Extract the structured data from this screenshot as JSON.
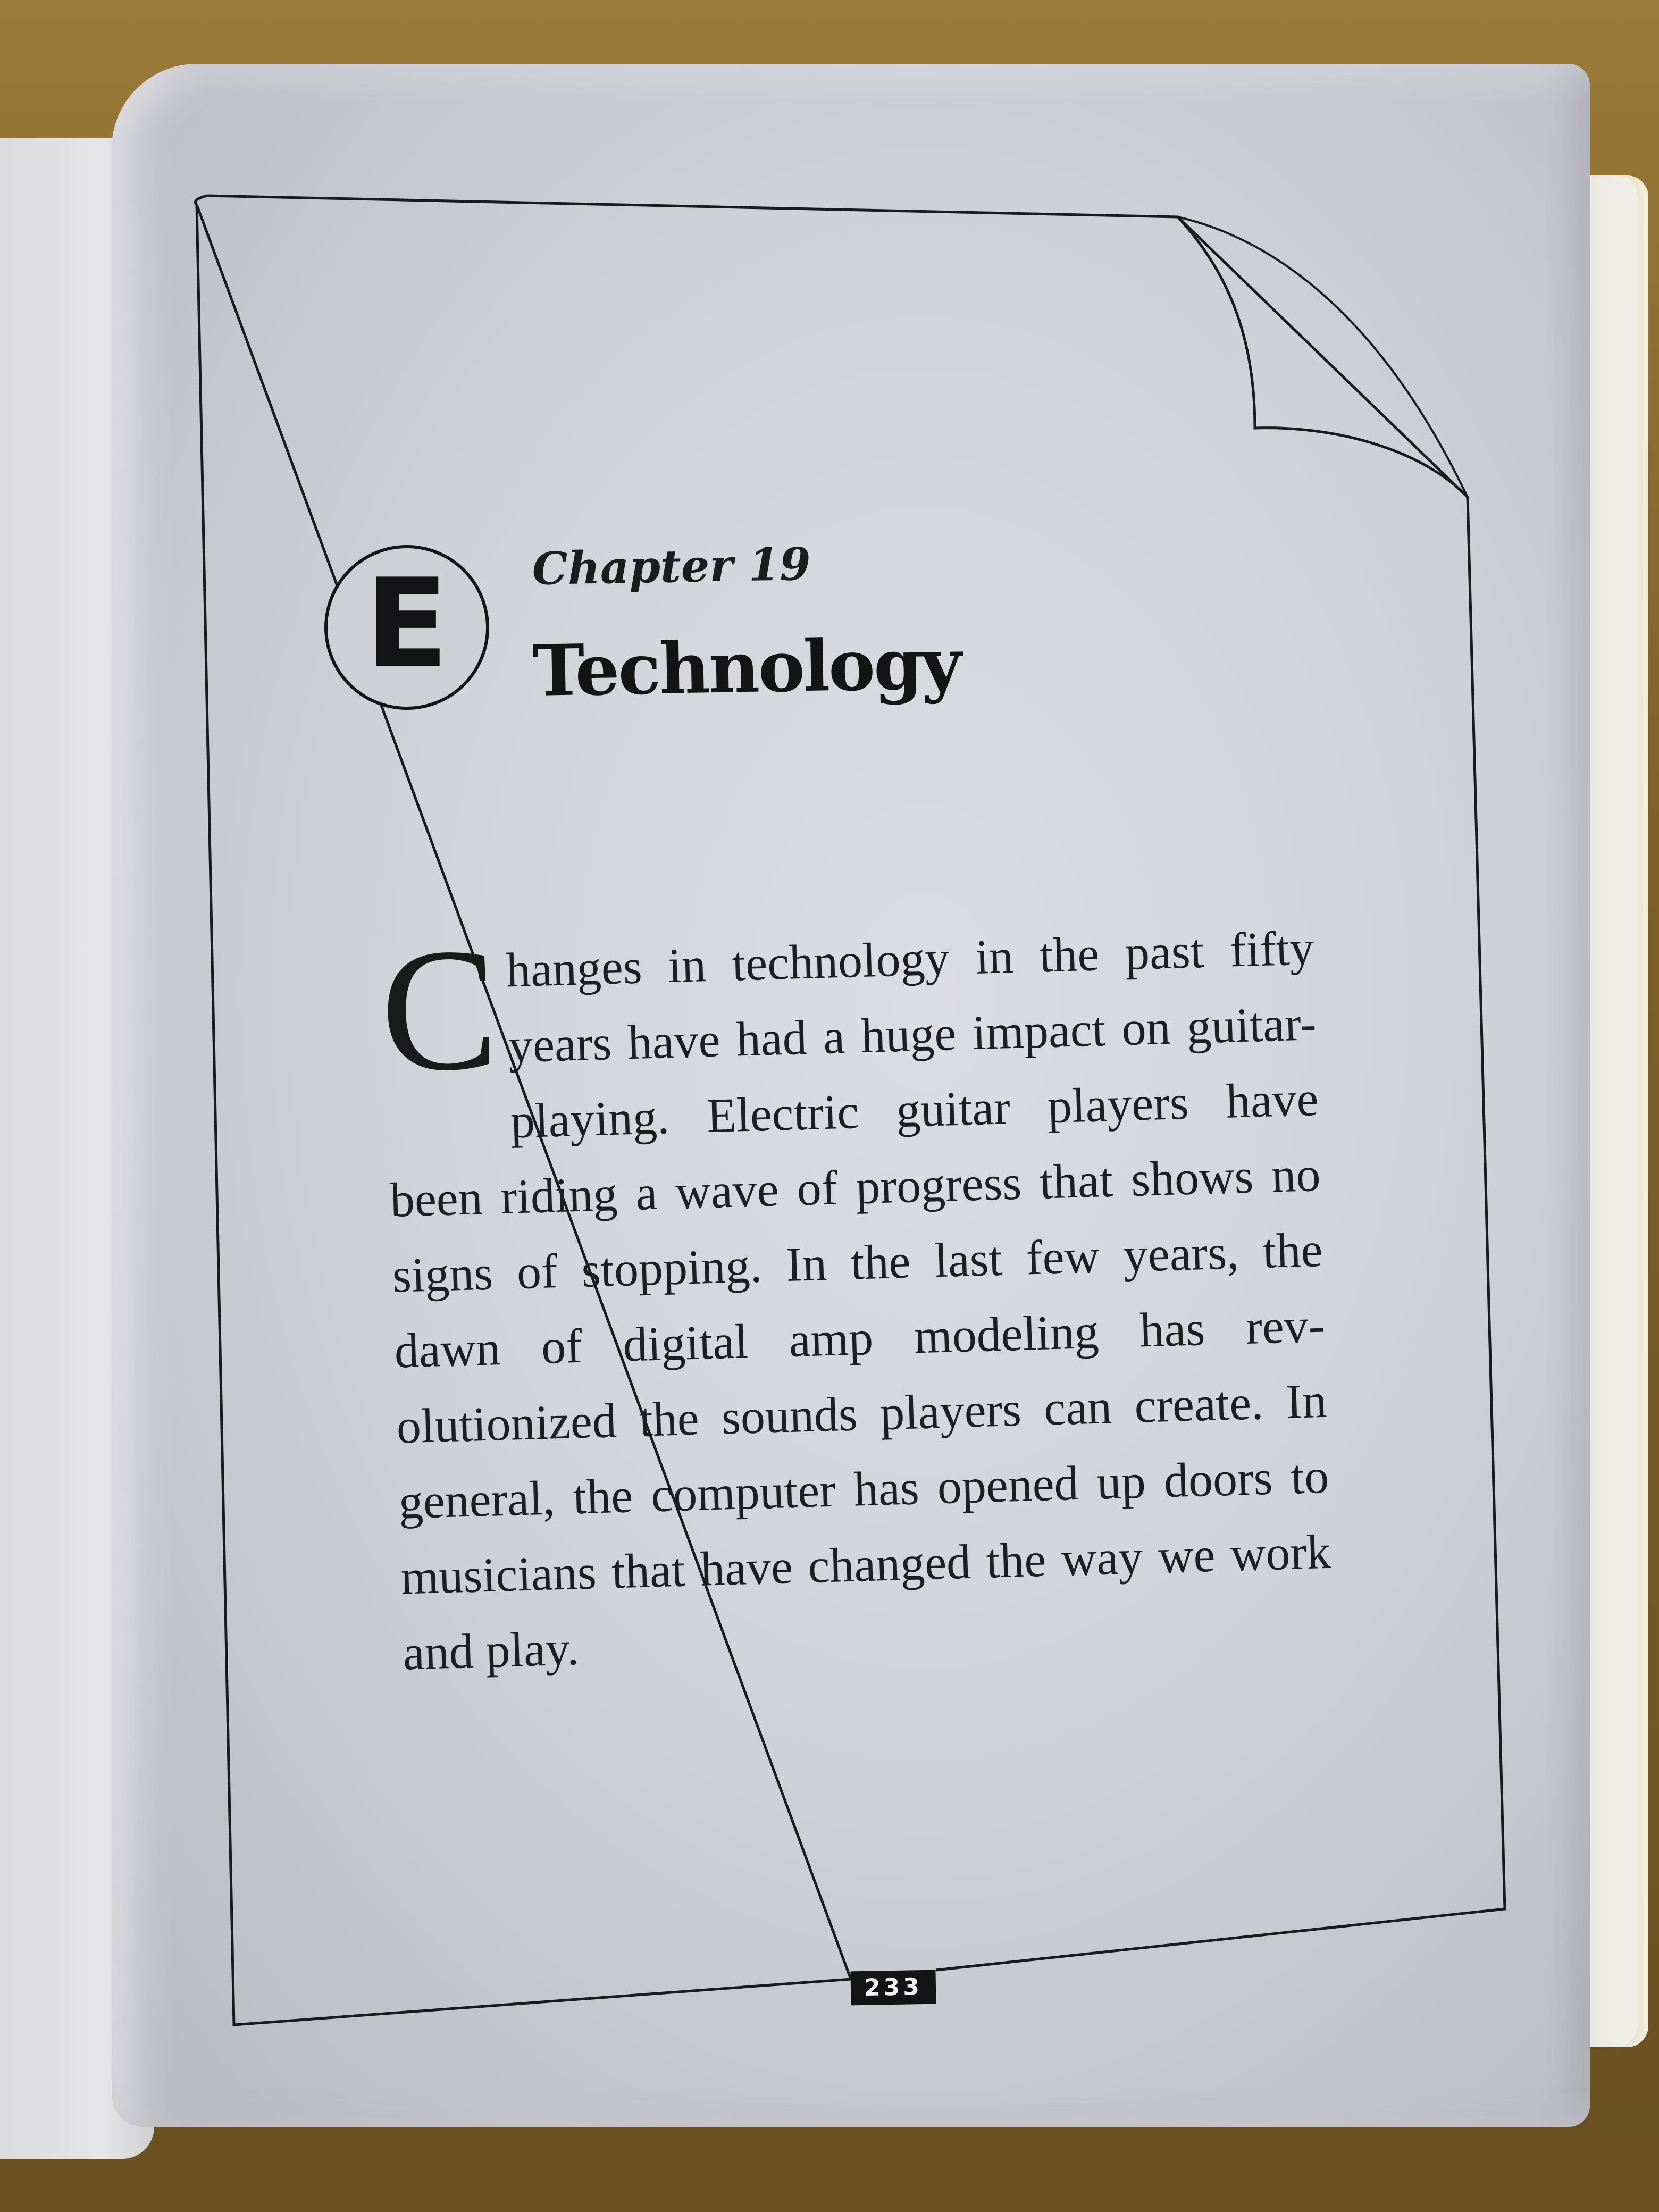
{
  "book_page": {
    "chapter_icon_letter": "E",
    "chapter_label": "Chapter 19",
    "chapter_title": "Technology",
    "drop_cap": "C",
    "body_text": "hanges in technology in the past fifty years have had a huge impact on guitar-playing. Electric guitar players have been riding a wave of progress that shows no signs of stopping. In the last few years, the dawn of digital amp modeling has rev-olutionized the sounds players can create. In general, the computer has opened up doors to musicians that have changed the way we work and play.",
    "page_number": "233"
  }
}
